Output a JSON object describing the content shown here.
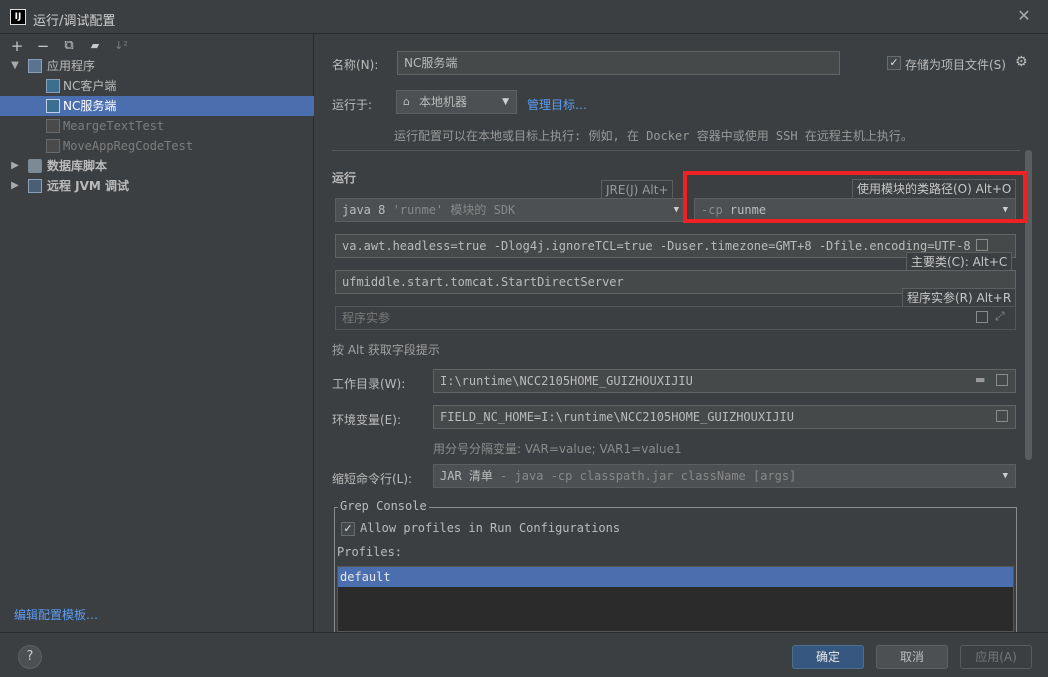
{
  "window": {
    "icon_text": "IJ",
    "title": "运行/调试配置",
    "close_glyph": "✕"
  },
  "toolbar": {
    "add": "+",
    "remove": "−",
    "copy": "⧉",
    "folder": "▰",
    "sort": "↓²"
  },
  "tree": {
    "app_group": "应用程序",
    "items": [
      "NC客户端",
      "NC服务端",
      "MeargeTextTest",
      "MoveAppRegCodeTest"
    ],
    "db_group": "数据库脚本",
    "jvm_group": "远程 JVM 调试"
  },
  "edit_templates": "编辑配置模板…",
  "form": {
    "name_label": "名称(N):",
    "name_value": "NC服务端",
    "store_label": "存储为项目文件(S)",
    "run_on_label": "运行于:",
    "run_on_value": "本地机器",
    "manage_targets": "管理目标…",
    "run_on_hint": "运行配置可以在本地或目标上执行: 例如, 在 Docker 容器中或使用 SSH 在远程主机上执行。",
    "run_section": "运行",
    "jre_tooltip": "JRE(J) Alt+",
    "sdk_value_main": "java 8",
    "sdk_value_rest": " 'runme' 模块的 SDK",
    "module_tooltip": "使用模块的类路径(O) Alt+O",
    "cp_prefix": "-cp",
    "cp_value": "runme",
    "vm_options": "va.awt.headless=true -Dlog4j.ignoreTCL=true -Duser.timezone=GMT+8  -Dfile.encoding=UTF-8",
    "main_class_tooltip": "主要类(C): Alt+C",
    "main_class": "ufmiddle.start.tomcat.StartDirectServer",
    "args_tooltip": "程序实参(R) Alt+R",
    "args_placeholder": "程序实参",
    "alt_hint": "按 Alt 获取字段提示",
    "workdir_label": "工作目录(W):",
    "workdir_value": "I:\\runtime\\NCC2105HOME_GUIZHOUXIJIU",
    "env_label": "环境变量(E):",
    "env_value": "FIELD_NC_HOME=I:\\runtime\\NCC2105HOME_GUIZHOUXIJIU",
    "env_hint": "用分号分隔变量: VAR=value; VAR1=value1",
    "shorten_label": "缩短命令行(L):",
    "shorten_main": "JAR 清单",
    "shorten_rest": " - java -cp classpath.jar className [args]"
  },
  "grep": {
    "title": "Grep Console",
    "allow_profiles": "Allow profiles in Run Configurations",
    "profiles_label": "Profiles:",
    "profiles": [
      "default"
    ]
  },
  "buttons": {
    "help": "?",
    "ok": "确定",
    "cancel": "取消",
    "apply": "应用(A)"
  },
  "colors": {
    "accent": "#4b6eaf",
    "primary_button": "#365880",
    "highlight": "#ee2222",
    "link": "#589df6"
  }
}
